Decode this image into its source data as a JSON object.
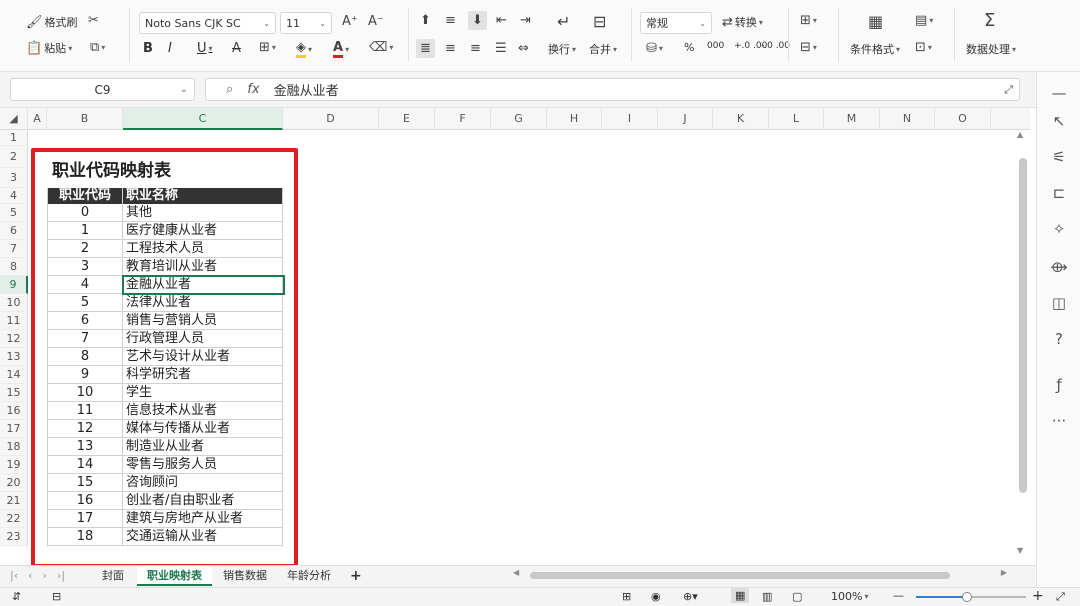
{
  "ribbon": {
    "format_painter": "格式刷",
    "paste": "粘贴",
    "font_name": "Noto Sans CJK SC",
    "font_size": "11",
    "bold": "B",
    "italic": "I",
    "underline": "U",
    "wrap": "换行",
    "merge": "合并",
    "number_format": "常规",
    "convert": "转换",
    "cond_format": "条件格式",
    "data_process": "数据处理",
    "percent": "%",
    "thousands": "000",
    "dec_inc": "+.0 .00",
    "dec_dec": "-.0 .00"
  },
  "formula": {
    "name_box": "C9",
    "fx": "fx",
    "content": "金融从业者"
  },
  "columns": [
    "A",
    "B",
    "C",
    "D",
    "E",
    "F",
    "G",
    "H",
    "I",
    "J",
    "K",
    "L",
    "M",
    "N",
    "O"
  ],
  "selected_column": "C",
  "rows": [
    "1",
    "2",
    "3",
    "4",
    "5",
    "6",
    "7",
    "8",
    "9",
    "10",
    "11",
    "12",
    "13",
    "14",
    "15",
    "16",
    "17",
    "18",
    "19",
    "20",
    "21",
    "22",
    "23"
  ],
  "selected_row": "9",
  "sheet": {
    "title": "职业代码映射表",
    "headers": [
      "职业代码",
      "职业名称"
    ],
    "entries": [
      {
        "code": "0",
        "name": "其他"
      },
      {
        "code": "1",
        "name": "医疗健康从业者"
      },
      {
        "code": "2",
        "name": "工程技术人员"
      },
      {
        "code": "3",
        "name": "教育培训从业者"
      },
      {
        "code": "4",
        "name": "金融从业者"
      },
      {
        "code": "5",
        "name": "法律从业者"
      },
      {
        "code": "6",
        "name": "销售与营销人员"
      },
      {
        "code": "7",
        "name": "行政管理人员"
      },
      {
        "code": "8",
        "name": "艺术与设计从业者"
      },
      {
        "code": "9",
        "name": "科学研究者"
      },
      {
        "code": "10",
        "name": "学生"
      },
      {
        "code": "11",
        "name": "信息技术从业者"
      },
      {
        "code": "12",
        "name": "媒体与传播从业者"
      },
      {
        "code": "13",
        "name": "制造业从业者"
      },
      {
        "code": "14",
        "name": "零售与服务人员"
      },
      {
        "code": "15",
        "name": "咨询顾问"
      },
      {
        "code": "16",
        "name": "创业者/自由职业者"
      },
      {
        "code": "17",
        "name": "建筑与房地产从业者"
      },
      {
        "code": "18",
        "name": "交通运输从业者"
      }
    ]
  },
  "tabs": [
    "封面",
    "职业映射表",
    "销售数据",
    "年龄分析"
  ],
  "active_tab": "职业映射表",
  "status": {
    "zoom": "100%"
  },
  "colors": {
    "accent": "#1c7a4c",
    "highlight_box": "#e02020",
    "header_fill": "#333333"
  }
}
